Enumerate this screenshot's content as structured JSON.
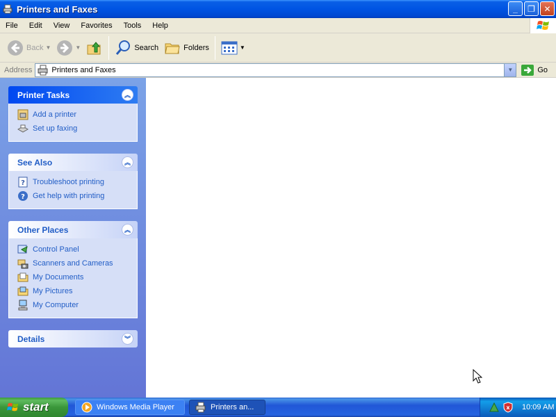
{
  "window": {
    "title": "Printers and Faxes",
    "buttons": {
      "minimize": "_",
      "restore": "❐",
      "close": "✕"
    }
  },
  "menu": [
    "File",
    "Edit",
    "View",
    "Favorites",
    "Tools",
    "Help"
  ],
  "toolbar": {
    "back": "Back",
    "search": "Search",
    "folders": "Folders"
  },
  "address": {
    "label": "Address",
    "value": "Printers and Faxes",
    "go": "Go"
  },
  "taskpane": {
    "printer_tasks": {
      "title": "Printer Tasks",
      "items": [
        "Add a printer",
        "Set up faxing"
      ]
    },
    "see_also": {
      "title": "See Also",
      "items": [
        "Troubleshoot printing",
        "Get help with printing"
      ]
    },
    "other_places": {
      "title": "Other Places",
      "items": [
        "Control Panel",
        "Scanners and Cameras",
        "My Documents",
        "My Pictures",
        "My Computer"
      ]
    },
    "details": {
      "title": "Details"
    }
  },
  "taskbar": {
    "start": "start",
    "tasks": [
      "Windows Media Player",
      "Printers an..."
    ],
    "clock": "10:09 AM"
  },
  "colors": {
    "titlebar": "#0054e3",
    "taskpane": "#6b8ce0",
    "link": "#215dc6",
    "start": "#3a963a"
  }
}
